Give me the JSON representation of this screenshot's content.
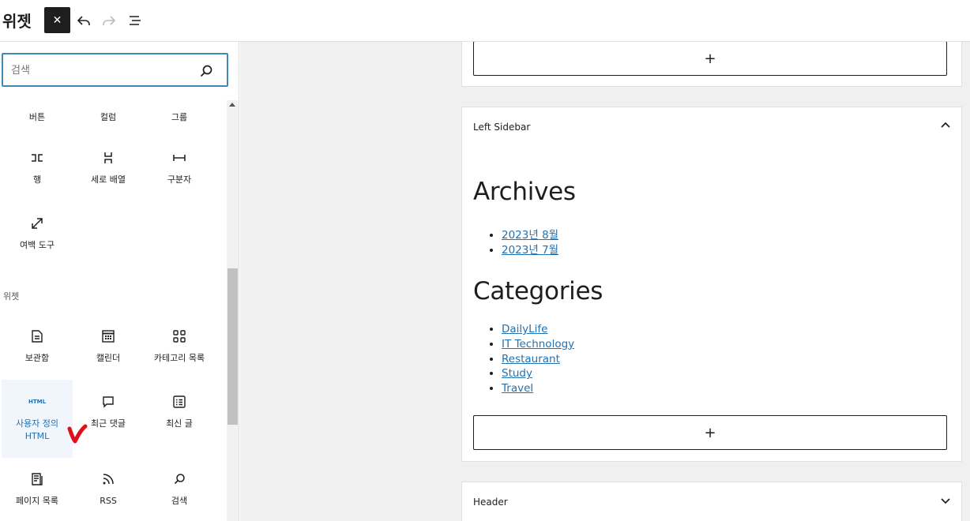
{
  "header": {
    "title": "위젯",
    "close_label": "✕"
  },
  "inserter": {
    "search_placeholder": "검색",
    "design_blocks": [
      {
        "label": "버튼",
        "icon": "buttons-icon"
      },
      {
        "label": "컬럼",
        "icon": "columns-icon"
      },
      {
        "label": "그룹",
        "icon": "group-icon"
      },
      {
        "label": "행",
        "icon": "row-icon"
      },
      {
        "label": "세로 배열",
        "icon": "stack-icon"
      },
      {
        "label": "구분자",
        "icon": "separator-icon"
      },
      {
        "label": "여백 도구",
        "icon": "spacer-icon"
      }
    ],
    "widgets_section_title": "위젯",
    "widget_blocks": [
      {
        "label": "보관함",
        "icon": "archive-icon"
      },
      {
        "label": "캘린더",
        "icon": "calendar-icon"
      },
      {
        "label": "카테고리 목록",
        "icon": "categories-icon"
      },
      {
        "label": "사용자 정의 HTML",
        "icon": "html-icon",
        "icon_text": "HTML",
        "selected": true
      },
      {
        "label": "최근 댓글",
        "icon": "comment-icon"
      },
      {
        "label": "최신 글",
        "icon": "latest-posts-icon"
      },
      {
        "label": "페이지 목록",
        "icon": "page-list-icon"
      },
      {
        "label": "RSS",
        "icon": "rss-icon"
      },
      {
        "label": "검색",
        "icon": "search-icon"
      }
    ]
  },
  "canvas": {
    "appender_symbol": "+",
    "left_sidebar": {
      "title": "Left Sidebar",
      "archives_heading": "Archives",
      "archives": [
        "2023년 8월",
        "2023년 7월"
      ],
      "categories_heading": "Categories",
      "categories": [
        "DailyLife",
        "IT Technology",
        "Restaurant",
        "Study",
        "Travel"
      ]
    },
    "header_area": {
      "title": "Header"
    }
  },
  "colors": {
    "accent": "#2271b1",
    "search_border": "#3f88b8",
    "selected_bg": "#f0f6fc",
    "checkmark": "#e0101a"
  }
}
